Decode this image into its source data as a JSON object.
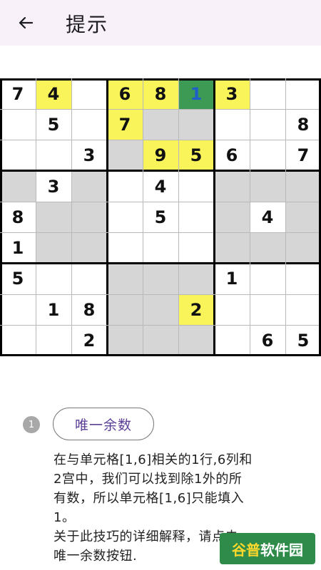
{
  "header": {
    "title": "提示",
    "back_icon": "arrow-left-icon"
  },
  "board": {
    "givens": [
      [
        "7",
        "4",
        "",
        "6",
        "8",
        "1",
        "3",
        "",
        ""
      ],
      [
        "",
        "5",
        "",
        "7",
        "",
        "",
        "",
        "",
        "8"
      ],
      [
        "",
        "",
        "3",
        "",
        "9",
        "5",
        "6",
        "",
        "7"
      ],
      [
        "",
        "3",
        "",
        "",
        "4",
        "",
        "",
        "",
        ""
      ],
      [
        "8",
        "",
        "",
        "",
        "5",
        "",
        "",
        "4",
        ""
      ],
      [
        "1",
        "",
        "",
        "",
        "",
        "",
        "",
        "",
        ""
      ],
      [
        "5",
        "",
        "",
        "",
        "",
        "",
        "1",
        "",
        ""
      ],
      [
        "",
        "1",
        "8",
        "",
        "",
        "2",
        "",
        "",
        ""
      ],
      [
        "",
        "",
        "2",
        "",
        "",
        "",
        "",
        "6",
        "5"
      ]
    ],
    "highlighted_cells": [
      [
        0,
        1
      ],
      [
        0,
        3
      ],
      [
        0,
        4
      ],
      [
        0,
        6
      ],
      [
        1,
        3
      ],
      [
        2,
        4
      ],
      [
        2,
        5
      ],
      [
        7,
        5
      ]
    ],
    "shaded_cells": [
      [
        1,
        4
      ],
      [
        1,
        5
      ],
      [
        2,
        3
      ],
      [
        3,
        0
      ],
      [
        3,
        2
      ],
      [
        3,
        6
      ],
      [
        3,
        7
      ],
      [
        3,
        8
      ],
      [
        4,
        1
      ],
      [
        4,
        2
      ],
      [
        4,
        6
      ],
      [
        4,
        8
      ],
      [
        5,
        1
      ],
      [
        5,
        2
      ],
      [
        5,
        6
      ],
      [
        5,
        7
      ],
      [
        5,
        8
      ],
      [
        6,
        3
      ],
      [
        6,
        4
      ],
      [
        6,
        5
      ],
      [
        7,
        3
      ],
      [
        7,
        4
      ],
      [
        8,
        3
      ],
      [
        8,
        4
      ],
      [
        8,
        5
      ]
    ],
    "target_cell": {
      "row": 0,
      "col": 5,
      "value": "1"
    },
    "colors": {
      "highlight": "#f8f45a",
      "shade": "#d6d6d6",
      "target_bg": "#3c9a55",
      "target_text": "#1f60c8",
      "thin_line": "#b9b9b9",
      "thick_line": "#000000"
    }
  },
  "hint": {
    "step_number": "1",
    "technique_label": "唯一余数"
  },
  "explanation": {
    "lines": [
      "在与单元格[1,6]相关的1行,6列和",
      "2宫中，我们可以找到除1外的所",
      "有数，所以单元格[1,6]只能填入",
      "1。",
      "关于此技巧的详细解释，请点击",
      "唯一余数按钮."
    ]
  },
  "watermark": {
    "accent": "谷普",
    "text": "软件园"
  }
}
